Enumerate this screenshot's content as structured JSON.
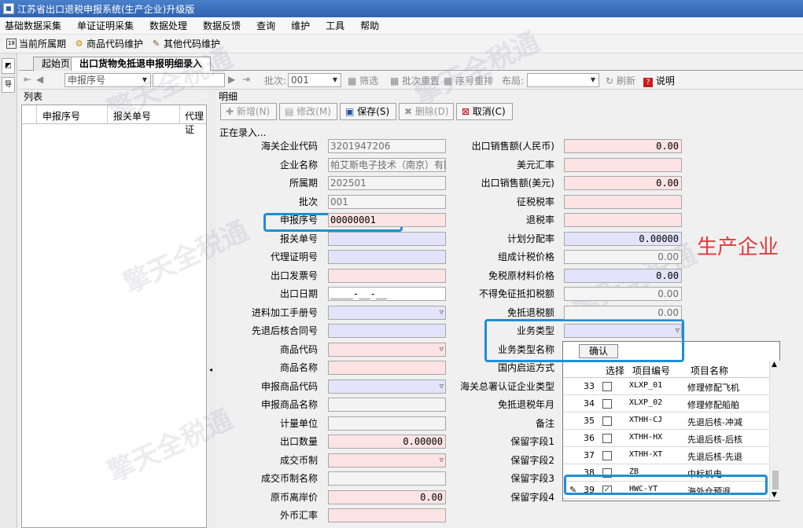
{
  "window": {
    "title": "江苏省出口退税申报系统(生产企业)升级版"
  },
  "menu": [
    "基础数据采集",
    "单证证明采集",
    "数据处理",
    "数据反馈",
    "查询",
    "维护",
    "工具",
    "帮助"
  ],
  "toolbar": [
    {
      "icon": "calendar-icon",
      "label": "当前所属期"
    },
    {
      "icon": "gear-icon",
      "label": "商品代码维护"
    },
    {
      "icon": "tool-icon",
      "label": "其他代码维护"
    }
  ],
  "tabs": [
    "起始页",
    "出口货物免抵退申报明细录入"
  ],
  "tool2": {
    "search_field": "申报序号",
    "batch_label": "批次:",
    "batch_value": "001",
    "filter": "筛选",
    "batch_reset": "批次重置",
    "seq_reorder": "序号重排",
    "layout_label": "布局:",
    "refresh": "刷新",
    "help": "说明"
  },
  "list": {
    "title": "列表",
    "columns": [
      "申报序号",
      "报关单号",
      "代理证"
    ]
  },
  "detail": {
    "title": "明细",
    "buttons": {
      "add": "新增(N)",
      "edit": "修改(M)",
      "save": "保存(S)",
      "delete": "删除(D)",
      "cancel": "取消(C)"
    },
    "status": "正在录入...",
    "left_labels": [
      "海关企业代码",
      "企业名称",
      "所属期",
      "批次",
      "申报序号",
      "报关单号",
      "代理证明号",
      "出口发票号",
      "出口日期",
      "进料加工手册号",
      "先退后核合同号",
      "商品代码",
      "商品名称",
      "申报商品代码",
      "申报商品名称",
      "计量单位",
      "出口数量",
      "成交币制",
      "成交币制名称",
      "原币离岸价",
      "外币汇率"
    ],
    "left_values": {
      "customs_code": "3201947206",
      "company_name": "帕艾斯电子技术（南京）有限",
      "period": "202501",
      "batch": "001",
      "decl_seq": "00000001",
      "export_date": "____-__-__",
      "export_qty": "0.00000",
      "fob_price": "0.00"
    },
    "right_labels": [
      "出口销售额(人民币)",
      "美元汇率",
      "出口销售额(美元)",
      "征税税率",
      "退税率",
      "计划分配率",
      "组成计税价格",
      "免税原材料价格",
      "不得免征抵扣税额",
      "免抵退税额",
      "业务类型",
      "业务类型名称",
      "国内启运方式",
      "海关总署认证企业类型",
      "免抵退税年月",
      "备注",
      "保留字段1",
      "保留字段2",
      "保留字段3",
      "保留字段4"
    ],
    "right_values": {
      "sales_rmb": "0.00",
      "sales_usd": "0.00",
      "plan_rate": "0.00000",
      "tax_price": "0.00",
      "raw_price": "0.00",
      "no_deduct": "0.00",
      "exempt_tax": "0.00"
    },
    "side_note": "生产企业"
  },
  "popup": {
    "confirm": "确认",
    "columns": [
      "选择",
      "项目编号",
      "项目名称"
    ],
    "rows": [
      {
        "num": "33",
        "code": "XLXP_01",
        "name": "修理修配飞机",
        "checked": false
      },
      {
        "num": "34",
        "code": "XLXP_02",
        "name": "修理修配船舶",
        "checked": false
      },
      {
        "num": "35",
        "code": "XTHH-CJ",
        "name": "先退后核-冲减",
        "checked": false
      },
      {
        "num": "36",
        "code": "XTHH-HX",
        "name": "先退后核-后核",
        "checked": false
      },
      {
        "num": "37",
        "code": "XTHH-XT",
        "name": "先退后核-先退",
        "checked": false
      },
      {
        "num": "38",
        "code": "ZB",
        "name": "中标机电",
        "checked": false
      },
      {
        "num": "39",
        "code": "HWC-YT",
        "name": "海外仓预退",
        "checked": true
      }
    ]
  },
  "colors": {
    "highlight": "#1e8fd6",
    "note_red": "#e03a3a",
    "pink_field": "#fde3e3",
    "lavender_field": "#e3e3fb"
  }
}
